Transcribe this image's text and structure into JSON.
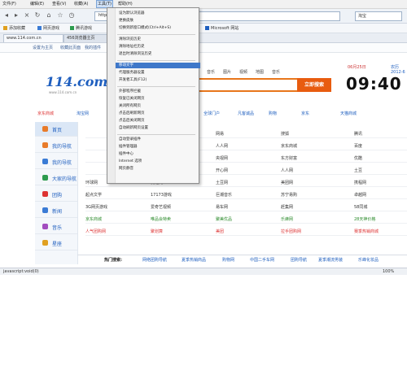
{
  "menubar": {
    "items": [
      "文件(F)",
      "编辑(E)",
      "查看(V)",
      "收藏(A)",
      "工具(T)",
      "帮助(H)"
    ],
    "active_index": 4
  },
  "navbar": {
    "back_icon": "back-arrow-icon",
    "forward_icon": "forward-arrow-icon",
    "address_value": "http://www.114.com.cn/",
    "search_value": "淘宝"
  },
  "favorites": {
    "items": [
      "添加收藏",
      "网页游戏",
      "腾讯游戏",
      "Hot",
      "懂人族",
      "网址库",
      "Microsoft 网站"
    ]
  },
  "tabs": {
    "items": [
      "www.114.com.cn",
      "456浏览器主页"
    ]
  },
  "page_tools": {
    "items": [
      "设置为主页",
      "收藏此页面",
      "我的插件",
      "页面"
    ]
  },
  "page": {
    "logo_text": "114.com",
    "logo_url": "www.114.com.cn",
    "categories": [
      "网页",
      "音乐",
      "图片",
      "视频",
      "地图",
      "音乐"
    ],
    "search_button": "立即搜索",
    "date": "06月25日",
    "clock": "09:40",
    "tip": "农历 2012-6",
    "quick_links": [
      "京东商城",
      "淘宝网",
      "新浪微博",
      "一号店",
      "腾讯",
      "全球门户",
      "凡客诚品",
      "购物",
      "京东",
      "天猫商城"
    ],
    "left_nav": [
      "首页",
      "我的导航",
      "我的导航",
      "大家的导航",
      "团购",
      "新闻",
      "音乐",
      "星座"
    ],
    "grid": [
      [
        "",
        "新浪",
        "网易",
        "搜狐",
        "腾讯"
      ],
      [
        "",
        "淘宝网",
        "人人网",
        "京东商城",
        "百度"
      ],
      [
        "",
        "凤凰网",
        "央视网",
        "东方财富",
        "优酷"
      ],
      [
        "",
        "土豆网",
        "开心网",
        "人人网",
        "土豆"
      ],
      [
        "环球网",
        "优酷网",
        "土豆网",
        "美团网",
        "携程网"
      ],
      [
        "起点文学",
        "17173游戏",
        "巨潮音乐",
        "苏宁易购",
        "卓越网"
      ],
      [
        "3G网页游戏",
        "爱奇艺视频",
        "易车网",
        "赶集网",
        "58同城"
      ],
      [
        "京东商城",
        "唯品会特卖",
        "聚美优品",
        "乐蜂网",
        "28天神价格"
      ],
      [
        "人气团购网",
        "聚划算",
        "美团",
        "拉手团购网",
        "赛季热销商城"
      ]
    ],
    "hot_label": "热门搜索:",
    "hot_items": [
      "网络团购导航",
      "夏季热销商品",
      "购物网",
      "中国二手车网",
      "团购导航",
      "夏季潮流男装",
      "乐峰化妆品"
    ]
  },
  "status": {
    "text": "javascript:void(0)",
    "zoom": "100%"
  },
  "tools_menu": {
    "items": [
      {
        "label": "设为默认浏览器",
        "type": "item"
      },
      {
        "label": "更换皮肤",
        "type": "item"
      },
      {
        "label": "切换到新窗口模式(Ctrl+Alt+S)",
        "type": "item"
      },
      {
        "label": "",
        "type": "sep"
      },
      {
        "label": "清除浏览历史",
        "type": "item"
      },
      {
        "label": "清除地址栏历史",
        "type": "item"
      },
      {
        "label": "退出时清除浏览历史",
        "type": "item"
      },
      {
        "label": "",
        "type": "sep"
      },
      {
        "label": "移动文字",
        "type": "highlight"
      },
      {
        "label": "代理服务器设置",
        "type": "item"
      },
      {
        "label": "开发者工具(F12)",
        "type": "item"
      },
      {
        "label": "",
        "type": "sep"
      },
      {
        "label": "外部程序拦截",
        "type": "item"
      },
      {
        "label": "恢复已关闭网页",
        "type": "item"
      },
      {
        "label": "关闭所有网页",
        "type": "item"
      },
      {
        "label": "点击后刷新网页",
        "type": "item"
      },
      {
        "label": "点击后关闭网页",
        "type": "item"
      },
      {
        "label": "自动刷新网页设置",
        "type": "item"
      },
      {
        "label": "",
        "type": "sep"
      },
      {
        "label": "自动登录插件",
        "type": "check"
      },
      {
        "label": "插件管理器",
        "type": "item"
      },
      {
        "label": "插件中心",
        "type": "item"
      },
      {
        "label": "Internet 选项",
        "type": "item"
      },
      {
        "label": "网页静音",
        "type": "check"
      }
    ]
  }
}
